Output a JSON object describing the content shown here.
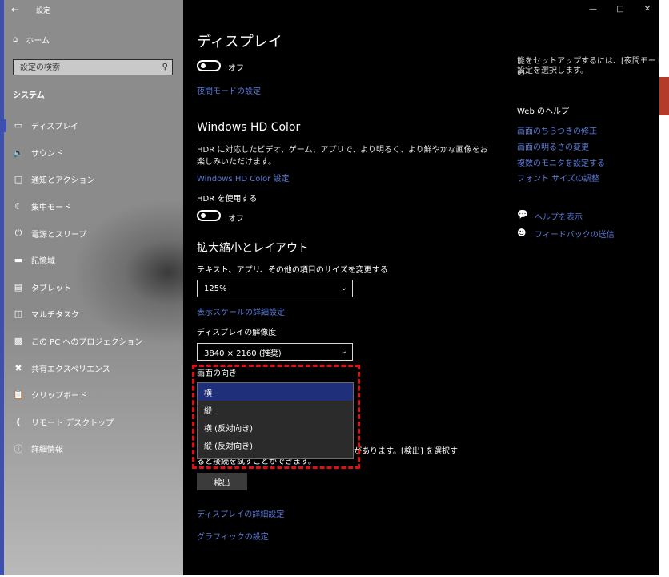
{
  "app_title": "設定",
  "home": "ホーム",
  "search": {
    "placeholder": "設定の検索"
  },
  "section": "システム",
  "nav": [
    {
      "label": "ディスプレイ",
      "icon": "monitor-icon"
    },
    {
      "label": "サウンド",
      "icon": "speaker-icon"
    },
    {
      "label": "通知とアクション",
      "icon": "notification-icon"
    },
    {
      "label": "集中モード",
      "icon": "moon-icon"
    },
    {
      "label": "電源とスリープ",
      "icon": "power-icon"
    },
    {
      "label": "記憶域",
      "icon": "storage-icon"
    },
    {
      "label": "タブレット",
      "icon": "tablet-icon"
    },
    {
      "label": "マルチタスク",
      "icon": "multitask-icon"
    },
    {
      "label": "この PC へのプロジェクション",
      "icon": "projection-icon"
    },
    {
      "label": "共有エクスペリエンス",
      "icon": "shared-icon"
    },
    {
      "label": "クリップボード",
      "icon": "clipboard-icon"
    },
    {
      "label": "リモート デスクトップ",
      "icon": "remote-desktop-icon"
    },
    {
      "label": "詳細情報",
      "icon": "info-icon"
    }
  ],
  "main": {
    "title": "ディスプレイ",
    "night_toggle_state": "オフ",
    "night_link": "夜間モードの設定",
    "hdr_heading": "Windows HD Color",
    "hdr_desc_1": "HDR に対応したビデオ、ゲーム、アプリで、より明るく、より鮮やかな画像をお",
    "hdr_desc_2": "楽しみいただけます。",
    "hdr_link": "Windows HD Color 設定",
    "hdr_use_label": "HDR を使用する",
    "hdr_toggle_state": "オフ",
    "scale_heading": "拡大縮小とレイアウト",
    "scale_label": "テキスト、アプリ、その他の項目のサイズを変更する",
    "scale_value": "125%",
    "scale_link": "表示スケールの詳細設定",
    "resolution_label": "ディスプレイの解像度",
    "resolution_value": "3840 × 2160 (推奨)",
    "orientation_label": "画面の向き",
    "orientation_options": [
      "横",
      "縦",
      "横 (反対向き)",
      "縦 (反対向き)"
    ],
    "detect_text_1": "があります。[検出] を選択す",
    "detect_text_2": "ると接続を試すことができます。",
    "detect_button": "検出",
    "advanced_link": "ディスプレイの詳細設定",
    "graphics_link": "グラフィックの設定"
  },
  "right": {
    "top_text_1": "能をセットアップするには、[夜間モード] の",
    "top_text_2": "設定を選択します。",
    "help_heading": "Web のヘルプ",
    "help_links": [
      "画面のちらつきの修正",
      "画面の明るさの変更",
      "複数のモニタを設定する",
      "フォント サイズの調整"
    ],
    "show_help": "ヘルプを表示",
    "feedback": "フィードバックの送信"
  }
}
